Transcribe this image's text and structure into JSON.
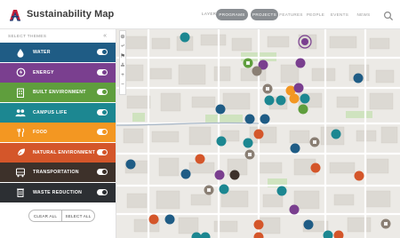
{
  "app": {
    "title": "Sustainability Map"
  },
  "header": {
    "layers_label": "LAYERS",
    "tabs": [
      {
        "label": "PROGRAMS",
        "active": true
      },
      {
        "label": "PROJECTS",
        "active": true
      },
      {
        "label": "FEATURES",
        "active": false
      },
      {
        "label": "PEOPLE",
        "active": false
      },
      {
        "label": "EVENTS",
        "active": false
      },
      {
        "label": "NEWS",
        "active": false
      }
    ]
  },
  "sidebar": {
    "heading": "SELECT THEMES",
    "themes": [
      {
        "label": "WATER",
        "color": "#1f5c85",
        "icon": "water-drop-icon",
        "on": true
      },
      {
        "label": "ENERGY",
        "color": "#7a3f8f",
        "icon": "power-icon",
        "on": true
      },
      {
        "label": "BUILT ENVIRONMENT",
        "color": "#5f9e3d",
        "icon": "building-icon",
        "on": true
      },
      {
        "label": "CAMPUS LIFE",
        "color": "#1c8791",
        "icon": "people-icon",
        "on": true
      },
      {
        "label": "FOOD",
        "color": "#f39722",
        "icon": "food-icon",
        "on": true
      },
      {
        "label": "NATURAL ENVIRONMENT",
        "color": "#d4562a",
        "icon": "leaf-icon",
        "on": true
      },
      {
        "label": "TRANSPORTATION",
        "color": "#3d312a",
        "icon": "bus-icon",
        "on": true
      },
      {
        "label": "WASTE REDUCTION",
        "color": "#2c2f33",
        "icon": "trash-icon",
        "on": true
      }
    ],
    "clear_all": "CLEAR ALL",
    "select_all": "SELECT ALL"
  },
  "map": {
    "tools": [
      "crosshair-icon",
      "share-icon",
      "trophy-icon",
      "route-icon",
      "zoom-in-icon",
      "zoom-out-icon"
    ]
  }
}
